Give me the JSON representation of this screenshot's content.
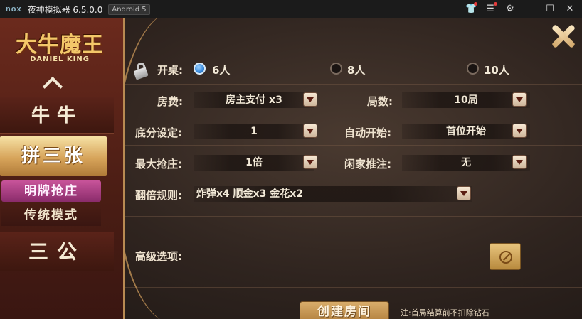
{
  "titlebar": {
    "logo": "nox",
    "app_name": "夜神模拟器 6.5.0.0",
    "android_badge": "Android 5",
    "icons": [
      "shirt-icon",
      "menu-icon",
      "gear-icon",
      "minimize-icon",
      "maximize-icon",
      "close-icon"
    ]
  },
  "game": {
    "logo": {
      "cn": "大牛魔王",
      "en": "DANIEL KING"
    },
    "sidebar": {
      "items": [
        {
          "label": "牛牛"
        },
        {
          "label": "拼三张",
          "selected": true
        },
        {
          "label": "明牌抢庄",
          "highlight": true
        },
        {
          "label": "传统模式"
        },
        {
          "label": "三公"
        }
      ]
    },
    "form": {
      "table_label": "开桌:",
      "table_options": [
        {
          "label": "6人",
          "checked": true
        },
        {
          "label": "8人",
          "checked": false
        },
        {
          "label": "10人",
          "checked": false
        }
      ],
      "room_fee_label": "房费:",
      "room_fee_value": "房主支付 x3",
      "rounds_label": "局数:",
      "rounds_value": "10局",
      "base_score_label": "底分设定:",
      "base_score_value": "1",
      "auto_start_label": "自动开始:",
      "auto_start_value": "首位开始",
      "max_bid_label": "最大抢庄:",
      "max_bid_value": "1倍",
      "idle_push_label": "闲家推注:",
      "idle_push_value": "无",
      "double_rule_label": "翻倍规则:",
      "double_rule_value": "炸弹x4  顺金x3  金花x2",
      "advanced_label": "高级选项:"
    },
    "create_button": "创建房间",
    "note": "注:首局结算前不扣除钻石",
    "colors": {
      "accent_gold": "#d9ad6b",
      "sidebar_red": "#6b2a1d",
      "highlight_pink": "#c8549a"
    }
  }
}
